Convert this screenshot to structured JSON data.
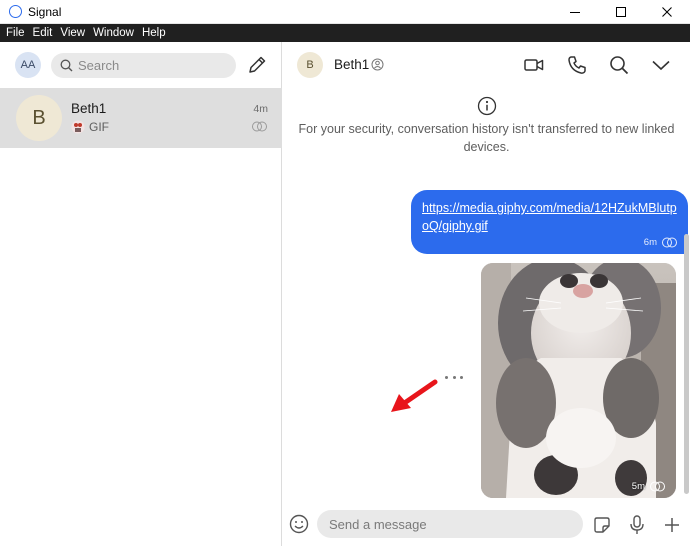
{
  "window": {
    "title": "Signal",
    "minimize": "minimize-icon",
    "maximize": "maximize-icon",
    "close": "close-icon"
  },
  "menu": [
    "File",
    "Edit",
    "View",
    "Window",
    "Help"
  ],
  "left": {
    "profile_initials": "AA",
    "search_placeholder": "Search",
    "conversations": [
      {
        "initial": "B",
        "name": "Beth1",
        "preview": "GIF",
        "time": "4m"
      }
    ]
  },
  "chat": {
    "contact_initial": "B",
    "contact_name": "Beth1",
    "security_notice": "For your security, conversation history isn't transferred to new linked devices.",
    "messages": [
      {
        "type": "link",
        "text": "https://media.giphy.com/media/12HZukMBlutpoQ/giphy.gif",
        "time": "6m"
      },
      {
        "type": "gif",
        "time": "5m"
      }
    ],
    "composer_placeholder": "Send a message"
  },
  "colors": {
    "accent": "#2c6bed",
    "menubar": "#202020",
    "selected_row": "#dedede",
    "annotation": "#e8151b"
  }
}
